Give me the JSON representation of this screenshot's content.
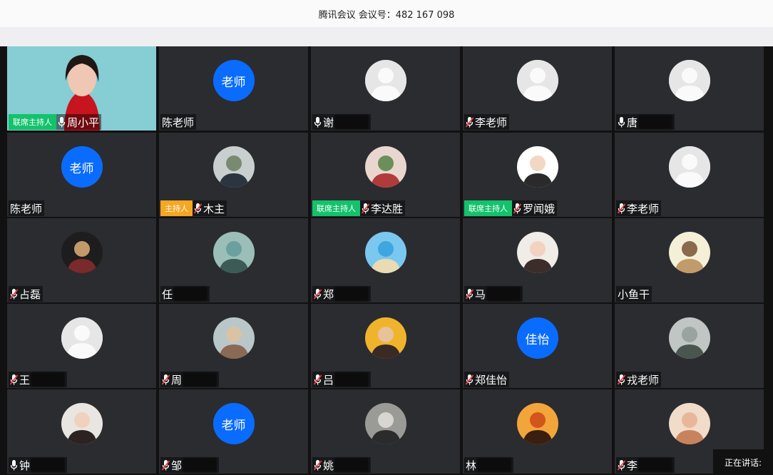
{
  "title": "腾讯会议 会议号：482 167 098",
  "speaking_label": "正在讲话:",
  "colors": {
    "cohost_badge": "#13c26b",
    "host_badge": "#f7a621",
    "text_avatar": "#0a6cff"
  },
  "participants": [
    {
      "name": "周小平",
      "role": "联席主持人",
      "avatar": "video",
      "mic": "on",
      "redacted": false
    },
    {
      "name": "陈老师",
      "role": "",
      "avatar": "text",
      "avatar_text": "老师",
      "mic": "none",
      "redacted": false
    },
    {
      "name": "谢",
      "role": "",
      "avatar": "default",
      "mic": "on",
      "redacted": true
    },
    {
      "name": "李老师",
      "role": "",
      "avatar": "default",
      "mic": "muted",
      "redacted": false
    },
    {
      "name": "唐",
      "role": "",
      "avatar": "default",
      "mic": "on",
      "redacted": true
    },
    {
      "name": "陈老师",
      "role": "",
      "avatar": "text",
      "avatar_text": "老师",
      "mic": "none",
      "redacted": false
    },
    {
      "name": "木主",
      "role": "主持人",
      "avatar": "photo-man",
      "mic": "muted",
      "redacted": false
    },
    {
      "name": "李达胜",
      "role": "联席主持人",
      "avatar": "photo-flowers",
      "mic": "muted",
      "redacted": false
    },
    {
      "name": "罗闻娥",
      "role": "联席主持人",
      "avatar": "photo-woman",
      "mic": "muted",
      "redacted": false
    },
    {
      "name": "李老师",
      "role": "",
      "avatar": "default",
      "mic": "muted",
      "redacted": false
    },
    {
      "name": "占磊",
      "role": "",
      "avatar": "photo-bears",
      "mic": "muted",
      "redacted": false
    },
    {
      "name": "任",
      "role": "",
      "avatar": "photo-coast",
      "mic": "none",
      "redacted": true
    },
    {
      "name": "郑",
      "role": "",
      "avatar": "photo-beach",
      "mic": "muted",
      "redacted": true
    },
    {
      "name": "马",
      "role": "",
      "avatar": "photo-girl",
      "mic": "muted",
      "redacted": true
    },
    {
      "name": "小鱼干",
      "role": "",
      "avatar": "photo-cartoon",
      "mic": "none",
      "redacted": false
    },
    {
      "name": "王",
      "role": "",
      "avatar": "default",
      "mic": "muted",
      "redacted": true
    },
    {
      "name": "周",
      "role": "",
      "avatar": "photo-yoga",
      "mic": "muted",
      "redacted": true
    },
    {
      "name": "吕",
      "role": "",
      "avatar": "photo-kid",
      "mic": "muted",
      "redacted": true
    },
    {
      "name": "郑佳怡",
      "role": "",
      "avatar": "text",
      "avatar_text": "佳怡",
      "mic": "muted",
      "redacted": false
    },
    {
      "name": "戎老师",
      "role": "",
      "avatar": "photo-fog",
      "mic": "muted",
      "redacted": false
    },
    {
      "name": "钟",
      "role": "",
      "avatar": "photo-woman2",
      "mic": "on",
      "redacted": true
    },
    {
      "name": "邹",
      "role": "",
      "avatar": "text",
      "avatar_text": "老师",
      "mic": "muted",
      "redacted": true
    },
    {
      "name": "姚",
      "role": "",
      "avatar": "photo-dance",
      "mic": "muted",
      "redacted": true
    },
    {
      "name": "林",
      "role": "",
      "avatar": "photo-sunset",
      "mic": "none",
      "redacted": true
    },
    {
      "name": "李",
      "role": "",
      "avatar": "photo-hands",
      "mic": "muted",
      "redacted": true
    }
  ]
}
